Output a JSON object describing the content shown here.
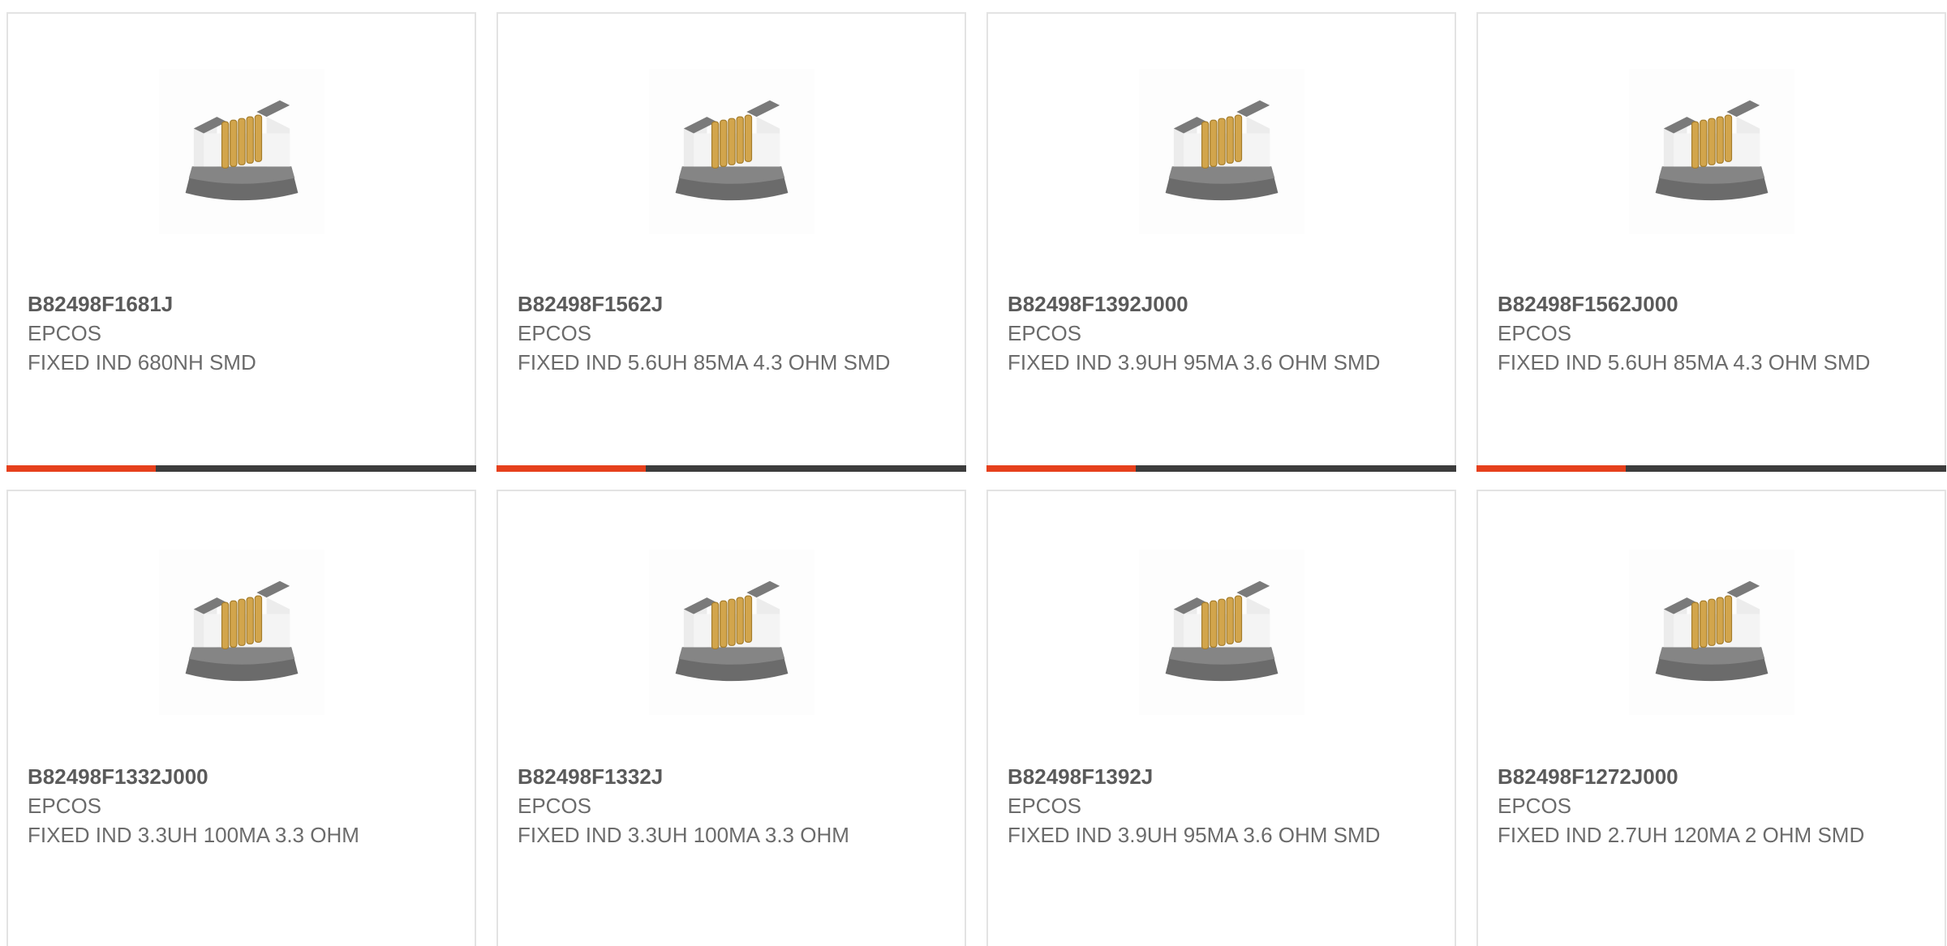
{
  "accent_color": "#e6401c",
  "bar_color": "#3c3c3c",
  "products": [
    {
      "part": "B82498F1681J",
      "maker": "EPCOS",
      "desc": "FIXED IND 680NH SMD",
      "icon": "smd-inductor-icon"
    },
    {
      "part": "B82498F1562J",
      "maker": "EPCOS",
      "desc": "FIXED IND 5.6UH 85MA 4.3 OHM SMD",
      "icon": "smd-inductor-icon"
    },
    {
      "part": "B82498F1392J000",
      "maker": "EPCOS",
      "desc": "FIXED IND 3.9UH 95MA 3.6 OHM SMD",
      "icon": "smd-inductor-icon"
    },
    {
      "part": "B82498F1562J000",
      "maker": "EPCOS",
      "desc": "FIXED IND 5.6UH 85MA 4.3 OHM SMD",
      "icon": "smd-inductor-icon"
    },
    {
      "part": "B82498F1332J000",
      "maker": "EPCOS",
      "desc": "FIXED IND 3.3UH 100MA 3.3 OHM",
      "icon": "smd-inductor-icon"
    },
    {
      "part": "B82498F1332J",
      "maker": "EPCOS",
      "desc": "FIXED IND 3.3UH 100MA 3.3 OHM",
      "icon": "smd-inductor-icon"
    },
    {
      "part": "B82498F1392J",
      "maker": "EPCOS",
      "desc": "FIXED IND 3.9UH 95MA 3.6 OHM SMD",
      "icon": "smd-inductor-icon"
    },
    {
      "part": "B82498F1272J000",
      "maker": "EPCOS",
      "desc": "FIXED IND 2.7UH 120MA 2 OHM SMD",
      "icon": "smd-inductor-icon"
    }
  ]
}
